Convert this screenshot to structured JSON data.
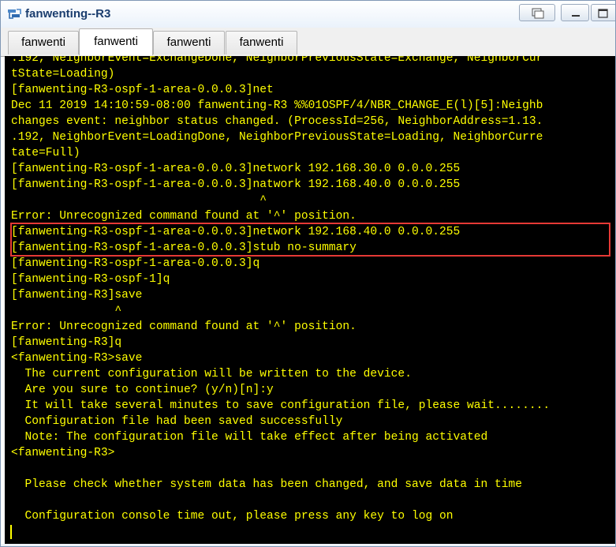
{
  "window": {
    "title": "fanwenting--R3",
    "app_icon": "network-device-icon"
  },
  "tabs": [
    {
      "label": "fanwenti",
      "active": false
    },
    {
      "label": "fanwenti",
      "active": true
    },
    {
      "label": "fanwenti",
      "active": false
    },
    {
      "label": "fanwenti",
      "active": false
    }
  ],
  "terminal": {
    "text_color": "#ffff00",
    "background": "#000000",
    "highlight_color": "#e53935",
    "lines": [
      ".192, NeighborEvent=ExchangeDone, NeighborPreviousState=Exchange, NeighborCur",
      "tState=Loading)",
      "[fanwenting-R3-ospf-1-area-0.0.0.3]net",
      "Dec 11 2019 14:10:59-08:00 fanwenting-R3 %%01OSPF/4/NBR_CHANGE_E(l)[5]:Neighb",
      "changes event: neighbor status changed. (ProcessId=256, NeighborAddress=1.13.",
      ".192, NeighborEvent=LoadingDone, NeighborPreviousState=Loading, NeighborCurre",
      "tate=Full)",
      "[fanwenting-R3-ospf-1-area-0.0.0.3]network 192.168.30.0 0.0.0.255",
      "[fanwenting-R3-ospf-1-area-0.0.0.3]natwork 192.168.40.0 0.0.0.255",
      "                                    ^",
      "Error: Unrecognized command found at '^' position.",
      "[fanwenting-R3-ospf-1-area-0.0.0.3]network 192.168.40.0 0.0.0.255",
      "[fanwenting-R3-ospf-1-area-0.0.0.3]stub no-summary",
      "[fanwenting-R3-ospf-1-area-0.0.0.3]q",
      "[fanwenting-R3-ospf-1]q",
      "[fanwenting-R3]save",
      "               ^",
      "Error: Unrecognized command found at '^' position.",
      "[fanwenting-R3]q",
      "<fanwenting-R3>save",
      "  The current configuration will be written to the device.",
      "  Are you sure to continue? (y/n)[n]:y",
      "  It will take several minutes to save configuration file, please wait........",
      "  Configuration file had been saved successfully",
      "  Note: The configuration file will take effect after being activated",
      "<fanwenting-R3>",
      "",
      "  Please check whether system data has been changed, and save data in time",
      "",
      "  Configuration console time out, please press any key to log on"
    ]
  }
}
